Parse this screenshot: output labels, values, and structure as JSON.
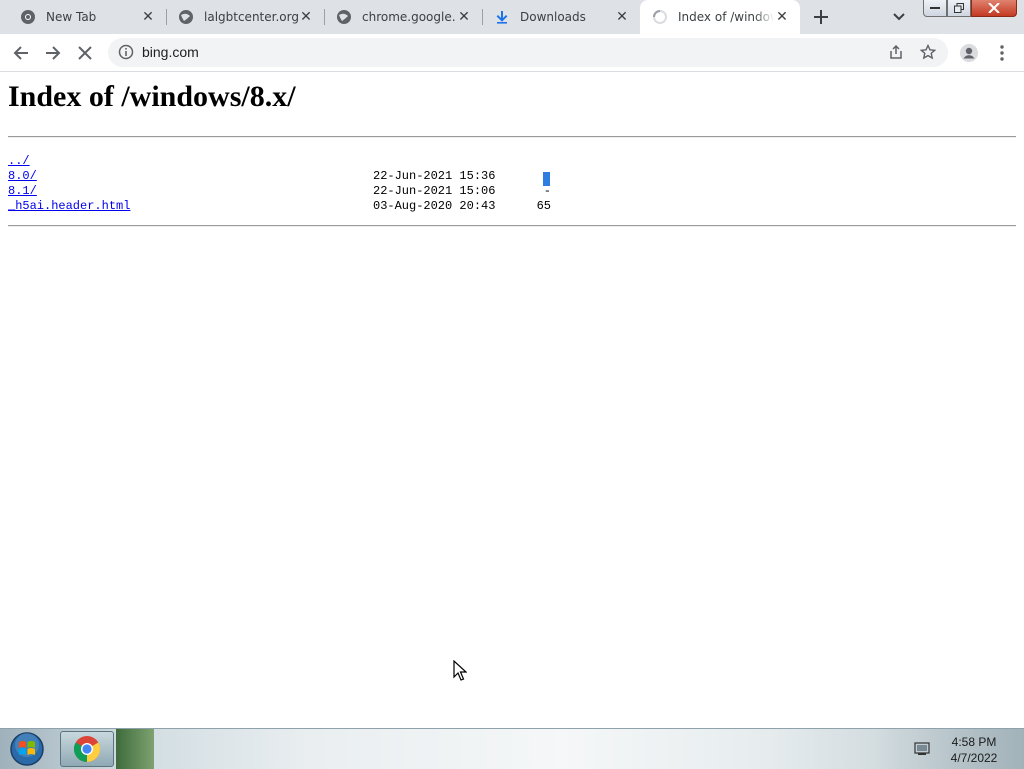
{
  "tabs": [
    {
      "label": "New Tab",
      "icon": "chrome-icon"
    },
    {
      "label": "lalgbtcenter.org",
      "icon": "globe-icon"
    },
    {
      "label": "chrome.google.co",
      "icon": "globe-icon"
    },
    {
      "label": "Downloads",
      "icon": "download-icon"
    },
    {
      "label": "Index of /window",
      "icon": "loading-spinner-icon",
      "active": true
    }
  ],
  "toolbar": {
    "url": "bing.com"
  },
  "page": {
    "title": "Index of /windows/8.x/",
    "entries": [
      {
        "name": "../",
        "date": "",
        "size": ""
      },
      {
        "name": "8.0/",
        "date": "22-Jun-2021 15:36",
        "size": "-"
      },
      {
        "name": "8.1/",
        "date": "22-Jun-2021 15:06",
        "size": "-"
      },
      {
        "name": "_h5ai.header.html",
        "date": "03-Aug-2020 20:43",
        "size": "65"
      }
    ]
  },
  "taskbar": {
    "time": "4:58 PM",
    "date": "4/7/2022"
  },
  "colors": {
    "link": "#0000ee",
    "tabstrip": "#dee1e6",
    "omnibox": "#f1f3f4",
    "selection": "#2f7de1"
  }
}
